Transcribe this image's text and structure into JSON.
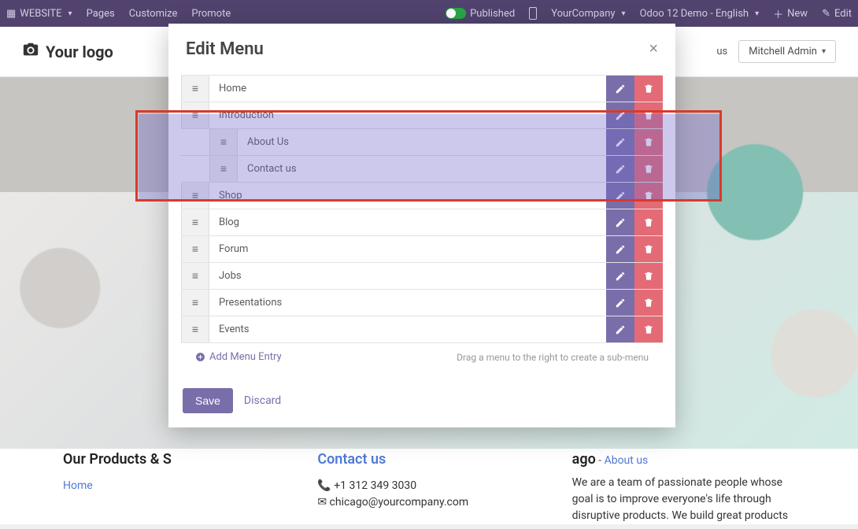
{
  "admin_bar": {
    "website_label": "WEBSITE",
    "pages": "Pages",
    "customize": "Customize",
    "promote": "Promote",
    "published": "Published",
    "company": "YourCompany",
    "demo": "Odoo 12 Demo - English",
    "new": "New",
    "edit": "Edit"
  },
  "site_header": {
    "logo_text": "Your logo",
    "nav_us": "us",
    "user_name": "Mitchell Admin"
  },
  "modal": {
    "title": "Edit Menu",
    "close": "×",
    "items": [
      {
        "label": "Home",
        "nested": false
      },
      {
        "label": "Introduction",
        "nested": false
      },
      {
        "label": "About Us",
        "nested": true
      },
      {
        "label": "Contact us",
        "nested": true
      },
      {
        "label": "Shop",
        "nested": false
      },
      {
        "label": "Blog",
        "nested": false
      },
      {
        "label": "Forum",
        "nested": false
      },
      {
        "label": "Jobs",
        "nested": false
      },
      {
        "label": "Presentations",
        "nested": false
      },
      {
        "label": "Events",
        "nested": false
      }
    ],
    "add_entry": "Add Menu Entry",
    "hint": "Drag a menu to the right to create a sub-menu",
    "save": "Save",
    "discard": "Discard"
  },
  "columns": {
    "c1": {
      "heading": "Our Products & S",
      "link": "Home"
    },
    "c2": {
      "heading_link": "Contact us",
      "phone": "+1 312 349 3030",
      "email": "chicago@yourcompany.com"
    },
    "c3": {
      "heading_suffix": "ago",
      "dash": " - ",
      "about_link": "About us",
      "body": "We are a team of passionate people whose goal is to improve everyone's life through disruptive products. We build great products"
    }
  }
}
